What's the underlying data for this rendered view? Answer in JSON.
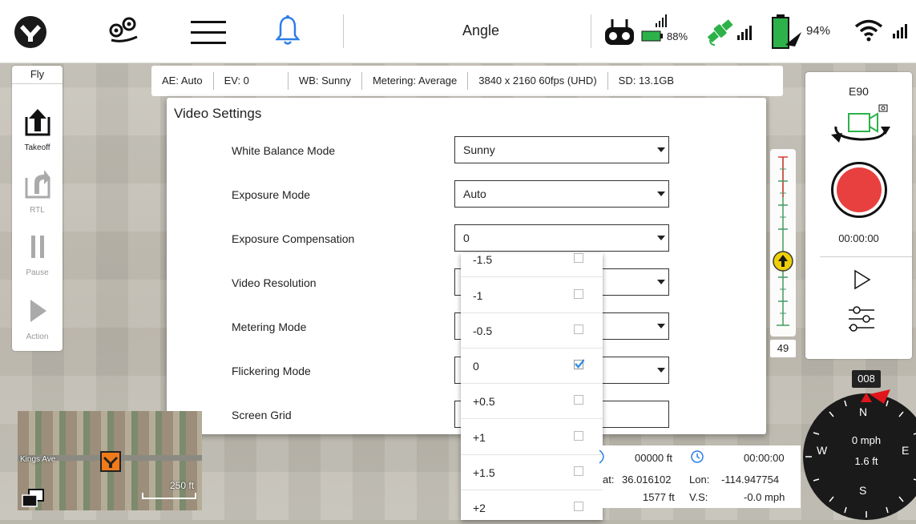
{
  "topbar": {
    "title": "Angle",
    "controller_battery": "88%",
    "drone_battery": "94%"
  },
  "left_panel": {
    "header": "Fly",
    "takeoff": "Takeoff",
    "rtl": "RTL",
    "pause": "Pause",
    "action": "Action"
  },
  "cam_bar": {
    "ae": "AE:  Auto",
    "ev": "EV:  0",
    "wb": "WB:  Sunny",
    "metering": "Metering:  Average",
    "resolution": "3840 x 2160 60fps (UHD)",
    "sd": "SD:  13.1GB"
  },
  "dialog": {
    "title": "Video Settings",
    "settings": [
      {
        "label": "White Balance Mode",
        "value": "Sunny"
      },
      {
        "label": "Exposure Mode",
        "value": "Auto"
      },
      {
        "label": "Exposure Compensation",
        "value": "0"
      },
      {
        "label": "Video Resolution",
        "value": ""
      },
      {
        "label": "Metering Mode",
        "value": ""
      },
      {
        "label": "Flickering Mode",
        "value": ""
      },
      {
        "label": "Screen Grid",
        "value": ""
      }
    ]
  },
  "dropdown": {
    "options": [
      {
        "label": "-1.5",
        "checked": false
      },
      {
        "label": "-1",
        "checked": false
      },
      {
        "label": "-0.5",
        "checked": false
      },
      {
        "label": "0",
        "checked": true
      },
      {
        "label": "+0.5",
        "checked": false
      },
      {
        "label": "+1",
        "checked": false
      },
      {
        "label": "+1.5",
        "checked": false
      },
      {
        "label": "+2",
        "checked": false
      }
    ]
  },
  "right_panel": {
    "camera_model": "E90",
    "record_time": "00:00:00"
  },
  "altitude": {
    "value": "49"
  },
  "telemetry": {
    "distance": "00000 ft",
    "flight_time": "00:00:00",
    "lat_label": "at:",
    "lat": "36.016102",
    "lon_label": "Lon:",
    "lon": "-114.947754",
    "altitude": "1577 ft",
    "vs_label": "V.S:",
    "vs": "-0.0 mph"
  },
  "compass": {
    "heading": "008",
    "speed": "0 mph",
    "height": "1.6 ft",
    "n": "N",
    "s": "S",
    "e": "E",
    "w": "W"
  },
  "minimap": {
    "street": "Kings Ave",
    "scale": "250 ft"
  },
  "colors": {
    "record": "#e8403f",
    "green": "#2db24a",
    "altitude_marker": "#f2d200",
    "compass_red": "#e0161b"
  }
}
